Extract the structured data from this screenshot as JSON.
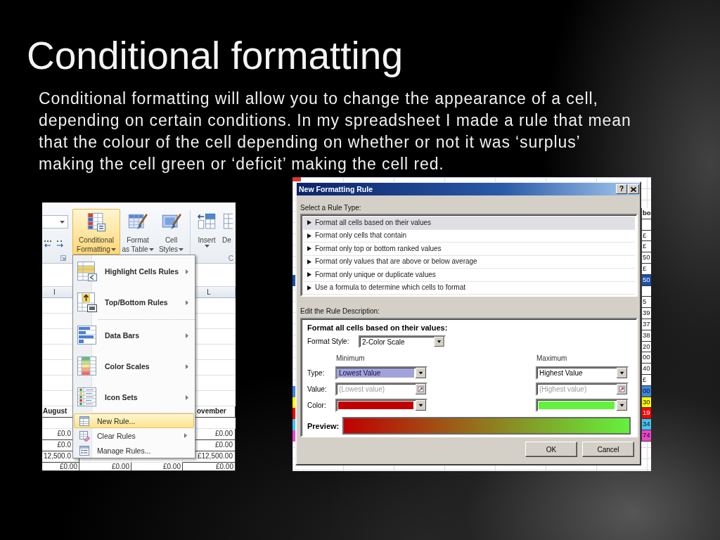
{
  "slide": {
    "title": "Conditional formatting",
    "body": "Conditional formatting will allow you to change the appearance of a cell, depending on certain conditions. In my spreadsheet I made a rule that mean that the colour of the cell depending on whether or not it was ‘surplus’ making the cell green or ‘deficit’ making the cell red."
  },
  "spreadsheet_screenshot": {
    "ribbon_groups": [
      {
        "buttons": [
          {
            "label_lines": [
              "Conditional",
              "Formatting"
            ],
            "dropdown": true,
            "selected": true
          },
          {
            "label_lines": [
              "Format",
              "as Table"
            ],
            "dropdown": true,
            "selected": false
          },
          {
            "label_lines": [
              "Cell",
              "Styles"
            ],
            "dropdown": true,
            "selected": false
          }
        ]
      },
      {
        "buttons": [
          {
            "label_lines": [
              "Insert"
            ],
            "dropdown": true,
            "selected": false
          },
          {
            "label_lines": [
              "De"
            ],
            "dropdown": false,
            "selected": false
          }
        ],
        "label": "C"
      }
    ],
    "column_headers": [
      "I",
      "L"
    ],
    "rows": [
      {
        "kind": "header",
        "first": "August",
        "last": "ovember"
      },
      {
        "kind": "blank"
      },
      {
        "kind": "value",
        "first": "£0.0",
        "last": "£0.00"
      },
      {
        "kind": "value",
        "first": "£0.0",
        "last": "£0.00"
      },
      {
        "kind": "value",
        "first": "12,500.0",
        "last": "£12,500.00"
      }
    ],
    "total_row": [
      "£0.00",
      "£0.00",
      "£0.00",
      "£0.00"
    ],
    "menu": [
      {
        "kind": "large",
        "label": "Highlight Cells Rules",
        "submenu": true,
        "highlighted": false
      },
      {
        "kind": "large",
        "label": "Top/Bottom Rules",
        "submenu": true,
        "highlighted": false
      },
      {
        "kind": "large",
        "label": "Data Bars",
        "submenu": true,
        "highlighted": false
      },
      {
        "kind": "large",
        "label": "Color Scales",
        "submenu": true,
        "highlighted": false
      },
      {
        "kind": "large",
        "label": "Icon Sets",
        "submenu": true,
        "highlighted": false
      },
      {
        "kind": "small",
        "label": "New Rule...",
        "submenu": false,
        "highlighted": true
      },
      {
        "kind": "small",
        "label": "Clear Rules",
        "submenu": true,
        "highlighted": false
      },
      {
        "kind": "small",
        "label": "Manage Rules...",
        "submenu": false,
        "highlighted": false
      }
    ]
  },
  "rule_dialog_screenshot": {
    "sheet_top_cell": {
      "color": "#d93a2e"
    },
    "sheet_rows": [
      {
        "kind": "header",
        "text": "bo"
      },
      {
        "kind": "blank"
      },
      {
        "kind": "text",
        "text": "£"
      },
      {
        "kind": "text",
        "text": "£"
      },
      {
        "kind": "text",
        "text": "50"
      },
      {
        "kind": "text",
        "text": "£"
      },
      {
        "kind": "text",
        "text": "50",
        "color": "#1f4ea8"
      },
      {
        "kind": "blank"
      },
      {
        "kind": "text",
        "text": "5"
      },
      {
        "kind": "text",
        "text": "39"
      },
      {
        "kind": "text",
        "text": "37"
      },
      {
        "kind": "text",
        "text": "38"
      },
      {
        "kind": "text",
        "text": "20"
      },
      {
        "kind": "text",
        "text": "00"
      },
      {
        "kind": "text",
        "text": "40"
      },
      {
        "kind": "text",
        "text": "£"
      },
      {
        "kind": "text",
        "text": "00",
        "color": "#3d85e0"
      },
      {
        "kind": "text",
        "text": "30",
        "color": "#ffff00"
      },
      {
        "kind": "text",
        "text": "19",
        "color": "#ff0000"
      },
      {
        "kind": "text",
        "text": "34",
        "color": "#44c4f0"
      },
      {
        "kind": "text",
        "text": "74",
        "color": "#ee44cc"
      }
    ],
    "dialog": {
      "title": "New Formatting Rule",
      "help_button": "?",
      "rule_type_label": "Select a Rule Type:",
      "rule_types": [
        {
          "label": "Format all cells based on their values",
          "selected": true
        },
        {
          "label": "Format only cells that contain",
          "selected": false
        },
        {
          "label": "Format only top or bottom ranked values",
          "selected": false
        },
        {
          "label": "Format only values that are above or below average",
          "selected": false
        },
        {
          "label": "Format only unique or duplicate values",
          "selected": false
        },
        {
          "label": "Use a formula to determine which cells to format",
          "selected": false
        }
      ],
      "description_label": "Edit the Rule Description:",
      "description_heading": "Format all cells based on their values:",
      "format_style": {
        "label": "Format Style:",
        "value": "2-Color Scale"
      },
      "row_labels": [
        "Type:",
        "Value:",
        "Color:"
      ],
      "ends": [
        {
          "heading": "Minimum",
          "type": "Lowest Value",
          "type_focused": true,
          "value": {
            "placeholder": "(Lowest value)"
          },
          "color": "#c00000"
        },
        {
          "heading": "Maximum",
          "type": "Highest Value",
          "type_focused": false,
          "value": {
            "placeholder": "(Highest value)"
          },
          "color": "#63f23c"
        }
      ],
      "preview_label": "Preview:",
      "buttons": [
        "OK",
        "Cancel"
      ]
    }
  }
}
